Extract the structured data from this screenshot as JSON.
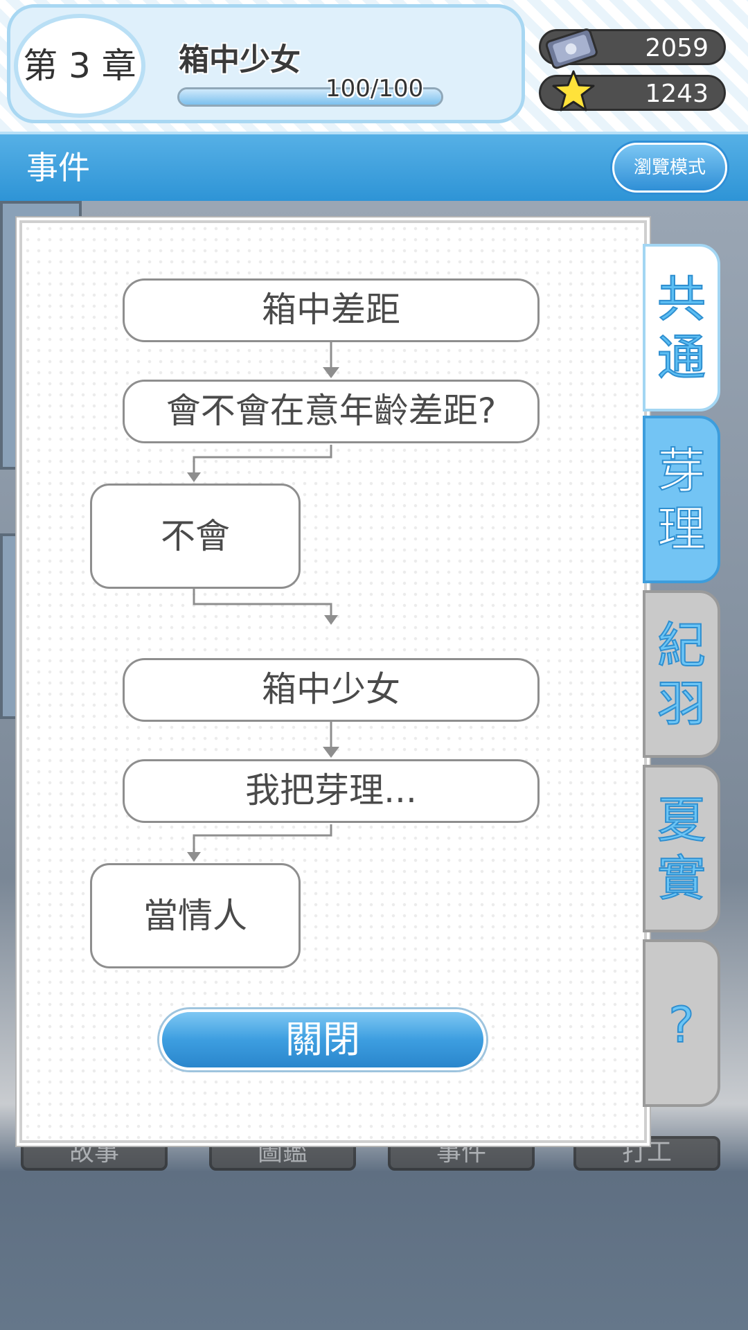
{
  "header": {
    "chapter_label": "第 3 章",
    "chapter_title": "箱中少女",
    "progress": {
      "text": "100/100",
      "percent": 100
    },
    "currencies": [
      {
        "icon": "ticket-icon",
        "value": "2059"
      },
      {
        "icon": "star-icon",
        "value": "1243"
      }
    ]
  },
  "title_bar": {
    "title": "事件",
    "browse_button": "瀏覽模式"
  },
  "flow": {
    "node1": "箱中差距",
    "node2": "會不會在意年齡差距?",
    "node3": "不會",
    "node4": "箱中少女",
    "node5": "我把芽理...",
    "node6": "當情人"
  },
  "close_button": "關閉",
  "side_tabs": [
    {
      "label": "共通",
      "state": "normal"
    },
    {
      "label": "芽理",
      "state": "active"
    },
    {
      "label": "紀羽",
      "state": "inactive"
    },
    {
      "label": "夏實",
      "state": "inactive"
    },
    {
      "label": "?",
      "state": "inactive"
    }
  ],
  "bottom_nav": [
    "故事",
    "圖鑑",
    "事件",
    "打工"
  ],
  "colors": {
    "accent": "#2e94d6",
    "tab_text": "#47b3ee",
    "box_border": "#8e8e8e"
  }
}
